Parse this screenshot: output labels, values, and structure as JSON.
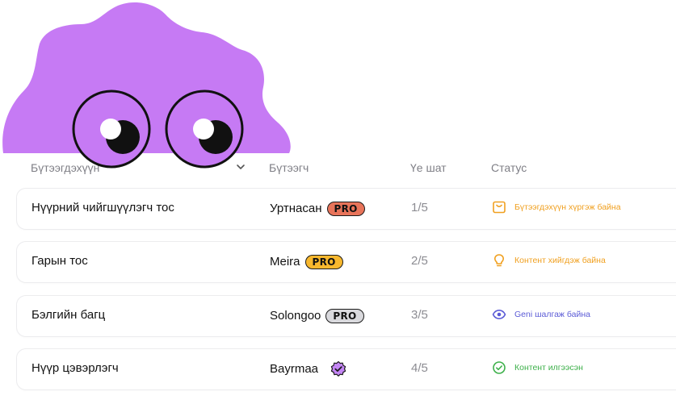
{
  "table": {
    "columns": {
      "product": "Бүтээгдэхүүн",
      "maker": "Бүтээгч",
      "stage": "Үе шат",
      "status": "Статус"
    },
    "rows": [
      {
        "product": "Нүүрний чийгшүүлэгч тос",
        "maker": "Уртнасан",
        "badge": "PRO",
        "badge_color": "#E8745A",
        "stage": "1/5",
        "status": "Бүтээгдэхүүн хүргэж байна",
        "status_color": "#F0A020",
        "status_icon": "package-icon"
      },
      {
        "product": "Гарын тос",
        "maker": "Meira",
        "badge": "PRO",
        "badge_color": "#F8B82E",
        "stage": "2/5",
        "status": "Контент хийгдэж байна",
        "status_color": "#F0A020",
        "status_icon": "lightbulb-icon"
      },
      {
        "product": "Бэлгийн багц",
        "maker": "Solongoo",
        "badge": "PRO",
        "badge_color": "#D9D9DD",
        "stage": "3/5",
        "status": "Geni шалгаж байна",
        "status_color": "#5B5BD6",
        "status_icon": "eye-icon"
      },
      {
        "product": "Нүүр цэвэрлэгч",
        "maker": "Bayrmaa",
        "badge": "",
        "badge_color": "#C486F5",
        "stage": "4/5",
        "status": "Контент илгээсэн",
        "status_color": "#3DB04A",
        "status_icon": "check-circle-icon"
      }
    ]
  },
  "colors": {
    "mascot": "#C67AF4",
    "border": "#ECECEE",
    "header_text": "#7F7F86"
  }
}
